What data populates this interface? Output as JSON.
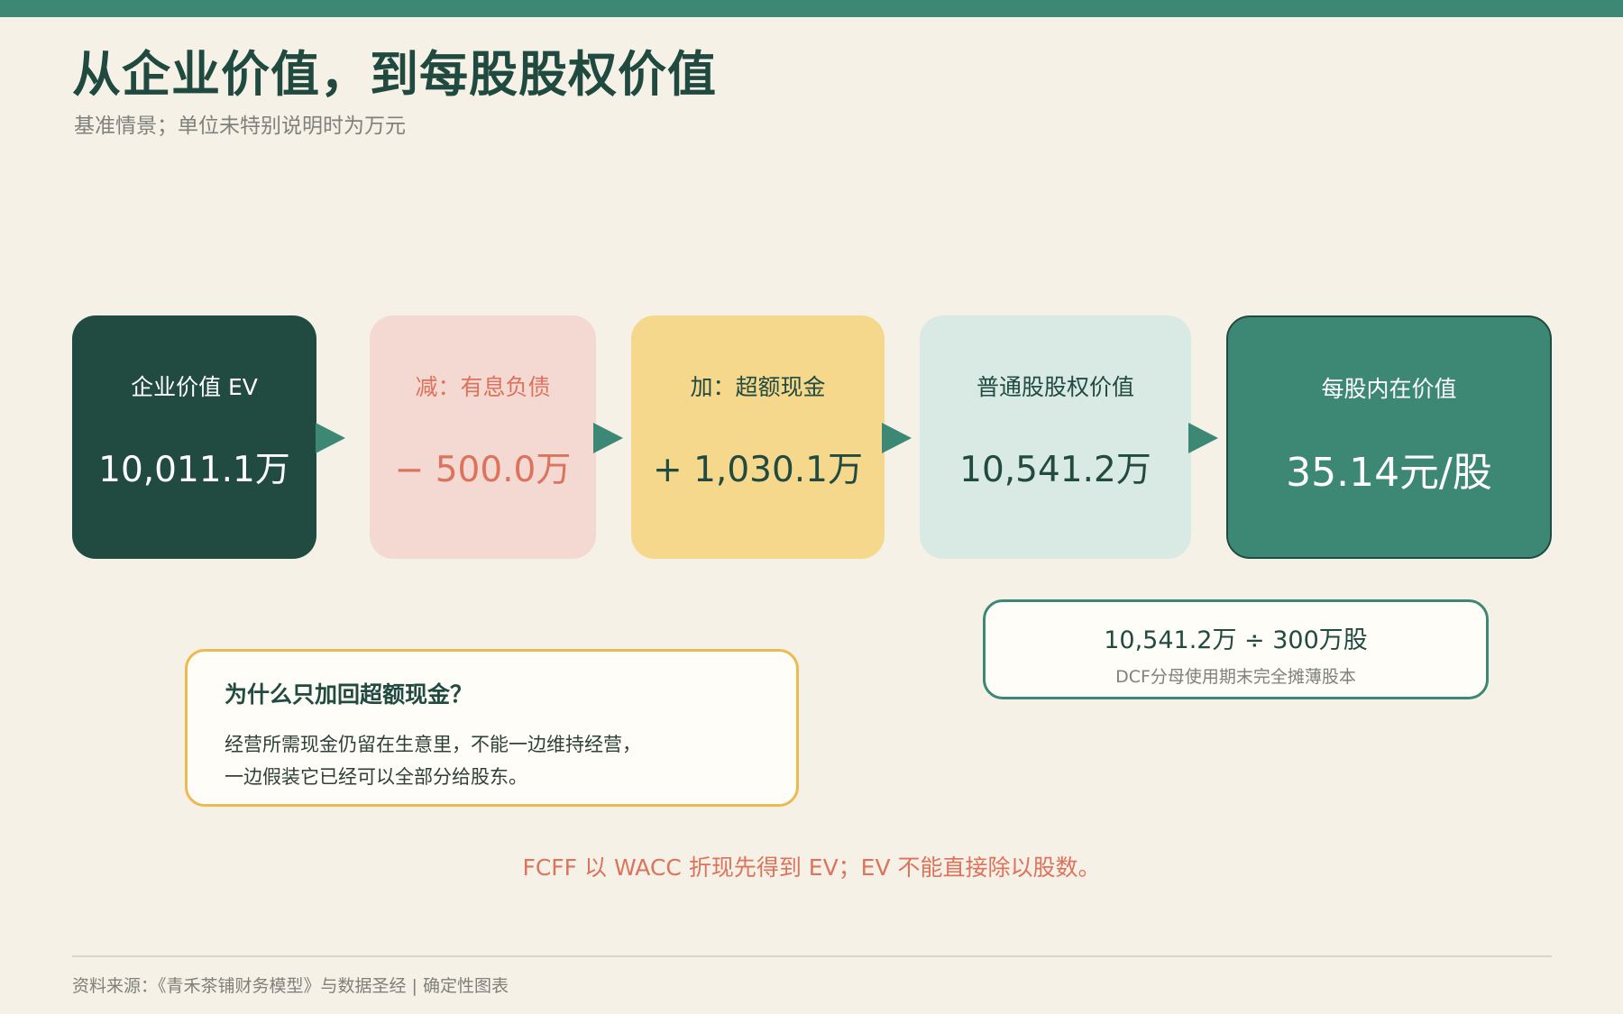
{
  "header": {
    "title": "从企业价值，到每股股权价值",
    "subtitle": "基准情景；单位未特别说明时为万元"
  },
  "flow": [
    {
      "label": "企业价值 EV",
      "value": "10,011.1万"
    },
    {
      "label": "减：有息负债",
      "value": "− 500.0万"
    },
    {
      "label": "加：超额现金",
      "value": "+ 1,030.1万"
    },
    {
      "label": "普通股股权价值",
      "value": "10,541.2万"
    },
    {
      "label": "每股内在价值",
      "value": "35.14元/股"
    }
  ],
  "formula": {
    "main": "10,541.2万 ÷ 300万股",
    "note": "DCF分母使用期末完全摊薄股本"
  },
  "callout": {
    "title": "为什么只加回超额现金？",
    "line1": "经营所需现金仍留在生意里，不能一边维持经营，",
    "line2": "一边假装它已经可以全部分给股东。"
  },
  "conclusion": "FCFF 以 WACC 折现先得到 EV；EV 不能直接除以股数。",
  "footer": {
    "source": "资料来源：《青禾茶铺财务模型》与数据圣经 | 确定性图表"
  },
  "colors": {
    "accent": "#3D8874",
    "dark_green": "#214B40",
    "debt_bg": "#F4D8D2",
    "debt_text": "#DC735C",
    "cash_bg": "#F5D88C",
    "equity_bg": "#D9E9E3",
    "callout_border": "#EBBA50",
    "background": "#F6F1E6"
  }
}
